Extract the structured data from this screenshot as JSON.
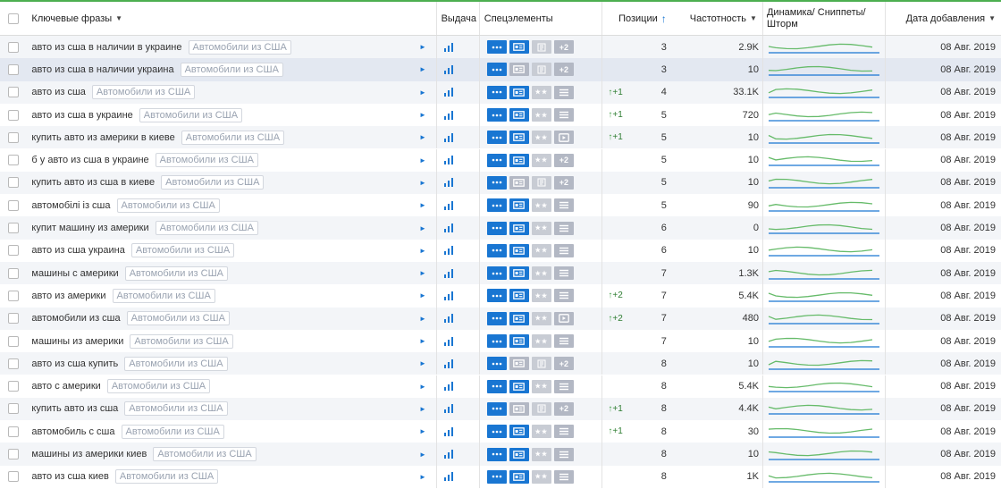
{
  "header": {
    "keywords": "Ключевые фразы",
    "vydacha": "Выдача",
    "spec": "Спецэлементы",
    "positions": "Позиции",
    "frequency": "Частотность",
    "dynamics": "Динамика/ Сниппеты/ Шторм",
    "date": "Дата добавления"
  },
  "tag_label": "Автомобили из США",
  "colors": {
    "accent": "#1976d2",
    "green": "#4caf50",
    "grey_badge": "#b3b8c4"
  },
  "rows": [
    {
      "kw": "авто из сша в наличии в украине",
      "s3": "book",
      "s4": "+2",
      "change": "",
      "pos": "3",
      "freq": "2.9K",
      "date": "08 Авг. 2019"
    },
    {
      "kw": "авто из сша в наличии украина",
      "s3": "book",
      "s4": "+2",
      "change": "",
      "pos": "3",
      "freq": "10",
      "date": "08 Авг. 2019"
    },
    {
      "kw": "авто из сша",
      "s3": "stars",
      "s4": "list",
      "change": "+1",
      "pos": "4",
      "freq": "33.1K",
      "date": "08 Авг. 2019"
    },
    {
      "kw": "авто из сша в украине",
      "s3": "stars",
      "s4": "list",
      "change": "+1",
      "pos": "5",
      "freq": "720",
      "date": "08 Авг. 2019"
    },
    {
      "kw": "купить авто из америки в киеве",
      "s3": "stars",
      "s4": "video",
      "change": "+1",
      "pos": "5",
      "freq": "10",
      "date": "08 Авг. 2019"
    },
    {
      "kw": "б у авто из сша в украине",
      "s3": "stars",
      "s4": "+2",
      "change": "",
      "pos": "5",
      "freq": "10",
      "date": "08 Авг. 2019"
    },
    {
      "kw": "купить авто из сша в киеве",
      "s3": "book",
      "s4": "+2",
      "change": "",
      "pos": "5",
      "freq": "10",
      "date": "08 Авг. 2019"
    },
    {
      "kw": "автомобілі із сша",
      "s3": "stars",
      "s4": "list",
      "change": "",
      "pos": "5",
      "freq": "90",
      "date": "08 Авг. 2019"
    },
    {
      "kw": "купит машину из америки",
      "s3": "stars",
      "s4": "list",
      "change": "",
      "pos": "6",
      "freq": "0",
      "date": "08 Авг. 2019"
    },
    {
      "kw": "авто из сша украина",
      "s3": "stars",
      "s4": "list",
      "change": "",
      "pos": "6",
      "freq": "10",
      "date": "08 Авг. 2019"
    },
    {
      "kw": "машины с америки",
      "s3": "stars",
      "s4": "list",
      "change": "",
      "pos": "7",
      "freq": "1.3K",
      "date": "08 Авг. 2019"
    },
    {
      "kw": "авто из америки",
      "s3": "stars",
      "s4": "list",
      "change": "+2",
      "pos": "7",
      "freq": "5.4K",
      "date": "08 Авг. 2019"
    },
    {
      "kw": "автомобили из сша",
      "s3": "stars",
      "s4": "video",
      "change": "+2",
      "pos": "7",
      "freq": "480",
      "date": "08 Авг. 2019"
    },
    {
      "kw": "машины из америки",
      "s3": "stars",
      "s4": "list",
      "change": "",
      "pos": "7",
      "freq": "10",
      "date": "08 Авг. 2019"
    },
    {
      "kw": "авто из сша купить",
      "s3": "book",
      "s4": "+2",
      "change": "",
      "pos": "8",
      "freq": "10",
      "date": "08 Авг. 2019"
    },
    {
      "kw": "авто с америки",
      "s3": "stars",
      "s4": "list",
      "change": "",
      "pos": "8",
      "freq": "5.4K",
      "date": "08 Авг. 2019"
    },
    {
      "kw": "купить авто из сша",
      "s3": "book",
      "s4": "+2",
      "change": "+1",
      "pos": "8",
      "freq": "4.4K",
      "date": "08 Авг. 2019"
    },
    {
      "kw": "автомобиль с сша",
      "s3": "stars",
      "s4": "list",
      "change": "+1",
      "pos": "8",
      "freq": "30",
      "date": "08 Авг. 2019"
    },
    {
      "kw": "машины из америки киев",
      "s3": "stars",
      "s4": "list",
      "change": "",
      "pos": "8",
      "freq": "10",
      "date": "08 Авг. 2019"
    },
    {
      "kw": "авто из сша киев",
      "s3": "stars",
      "s4": "list",
      "change": "",
      "pos": "8",
      "freq": "1K",
      "date": "08 Авг. 2019"
    }
  ]
}
